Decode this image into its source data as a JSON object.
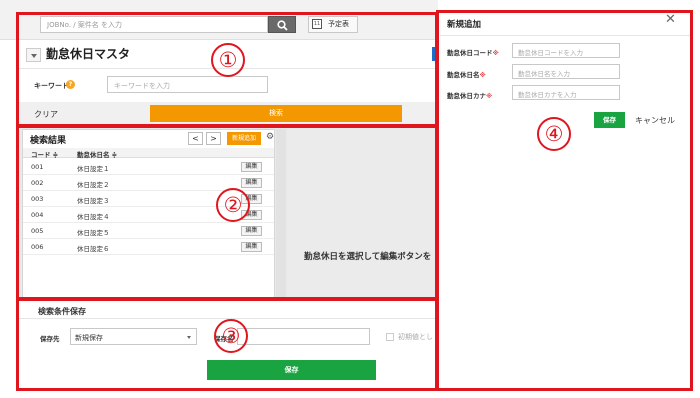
{
  "header": {
    "search_placeholder": "JOBNo. / 案件名 を入力",
    "schedule_label": "予定表",
    "calendar_day": "11"
  },
  "page": {
    "title": "勤怠休日マスタ",
    "keyword_label": "キーワード",
    "keyword_placeholder": "キーワードを入力",
    "clear_label": "クリア",
    "search_button": "検索"
  },
  "results": {
    "title": "検索結果",
    "prev": "<",
    "next": ">",
    "new_button": "新規追加",
    "columns": [
      "コード ≑",
      "勤怠休日名 ≑"
    ],
    "edit_label": "編集",
    "rows": [
      {
        "code": "001",
        "name": "休日設定１"
      },
      {
        "code": "002",
        "name": "休日設定２"
      },
      {
        "code": "003",
        "name": "休日設定３"
      },
      {
        "code": "004",
        "name": "休日設定４"
      },
      {
        "code": "005",
        "name": "休日設定５"
      },
      {
        "code": "006",
        "name": "休日設定６"
      }
    ],
    "detail_message": "勤怠休日を選択して編集ボタンを"
  },
  "save_conditions": {
    "title": "検索条件保存",
    "save_to_label": "保存先",
    "save_to_value": "新規保存",
    "save_name_label": "保存名",
    "default_label": "初期値とし",
    "save_button": "保存"
  },
  "dialog": {
    "title": "新規追加",
    "close": "✕",
    "fields": [
      {
        "label": "勤怠休日コード",
        "placeholder": "勤怠休日コードを入力"
      },
      {
        "label": "勤怠休日名",
        "placeholder": "勤怠休日名を入力"
      },
      {
        "label": "勤怠休日カナ",
        "placeholder": "勤怠休日カナを入力"
      }
    ],
    "required_mark": "※",
    "save_button": "保存",
    "cancel_button": "キャンセル"
  },
  "annotations": [
    "①",
    "②",
    "③",
    "④"
  ],
  "colors": {
    "accent_orange": "#f39800",
    "save_green": "#1aa341",
    "annotation_red": "#e0161f"
  }
}
